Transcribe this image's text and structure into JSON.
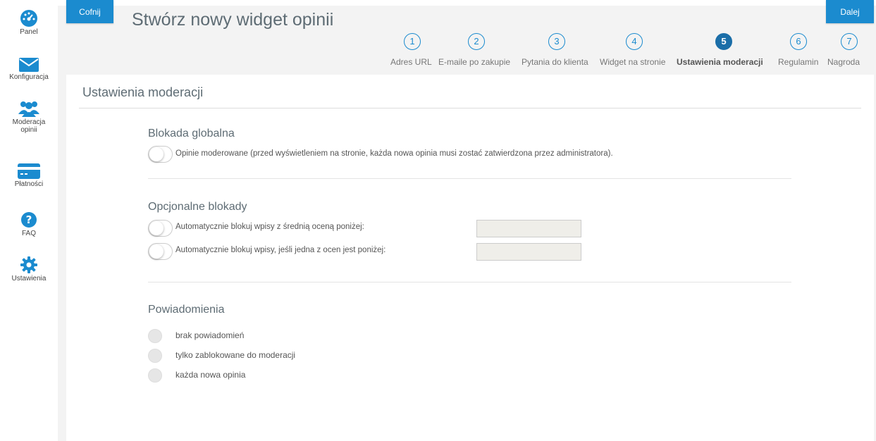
{
  "sidebar": {
    "items": [
      {
        "label": "Panel",
        "icon": "dashboard-icon"
      },
      {
        "label": "Konfiguracja",
        "icon": "envelope-icon"
      },
      {
        "label1": "Moderacja",
        "label2": "opinii",
        "icon": "users-icon"
      },
      {
        "label": "Płatności",
        "icon": "credit-card-icon"
      },
      {
        "label": "FAQ",
        "icon": "question-icon"
      },
      {
        "label": "Ustawienia",
        "icon": "gear-icon"
      }
    ]
  },
  "header": {
    "back_label": "Cofnij",
    "next_label": "Dalej",
    "title": "Stwórz nowy widget opinii"
  },
  "steps": [
    {
      "num": "1",
      "label": "Adres URL"
    },
    {
      "num": "2",
      "label": "E-maile po zakupie"
    },
    {
      "num": "3",
      "label": "Pytania do klienta"
    },
    {
      "num": "4",
      "label": "Widget na stronie"
    },
    {
      "num": "5",
      "label": "Ustawienia moderacji"
    },
    {
      "num": "6",
      "label": "Regulamin"
    },
    {
      "num": "7",
      "label": "Nagroda"
    }
  ],
  "active_step": 5,
  "panel": {
    "title": "Ustawienia moderacji",
    "global_block": {
      "title": "Blokada globalna",
      "option": "Opinie moderowane (przed wyświetleniem na stronie, każda nowa opinia musi zostać zatwierdzona przez administratora)."
    },
    "optional_blocks": {
      "title": "Opcjonalne blokady",
      "options": [
        {
          "label": "Automatycznie blokuj wpisy z średnią oceną poniżej:",
          "value": ""
        },
        {
          "label": "Automatycznie blokuj wpisy, jeśli jedna z ocen jest poniżej:",
          "value": ""
        }
      ]
    },
    "notifications": {
      "title": "Powiadomienia",
      "options": [
        "brak powiadomień",
        "tylko zablokowane do moderacji",
        "każda nowa opinia"
      ]
    }
  },
  "colors": {
    "accent": "#1b8bcf",
    "active_step": "#1b6ea8"
  }
}
